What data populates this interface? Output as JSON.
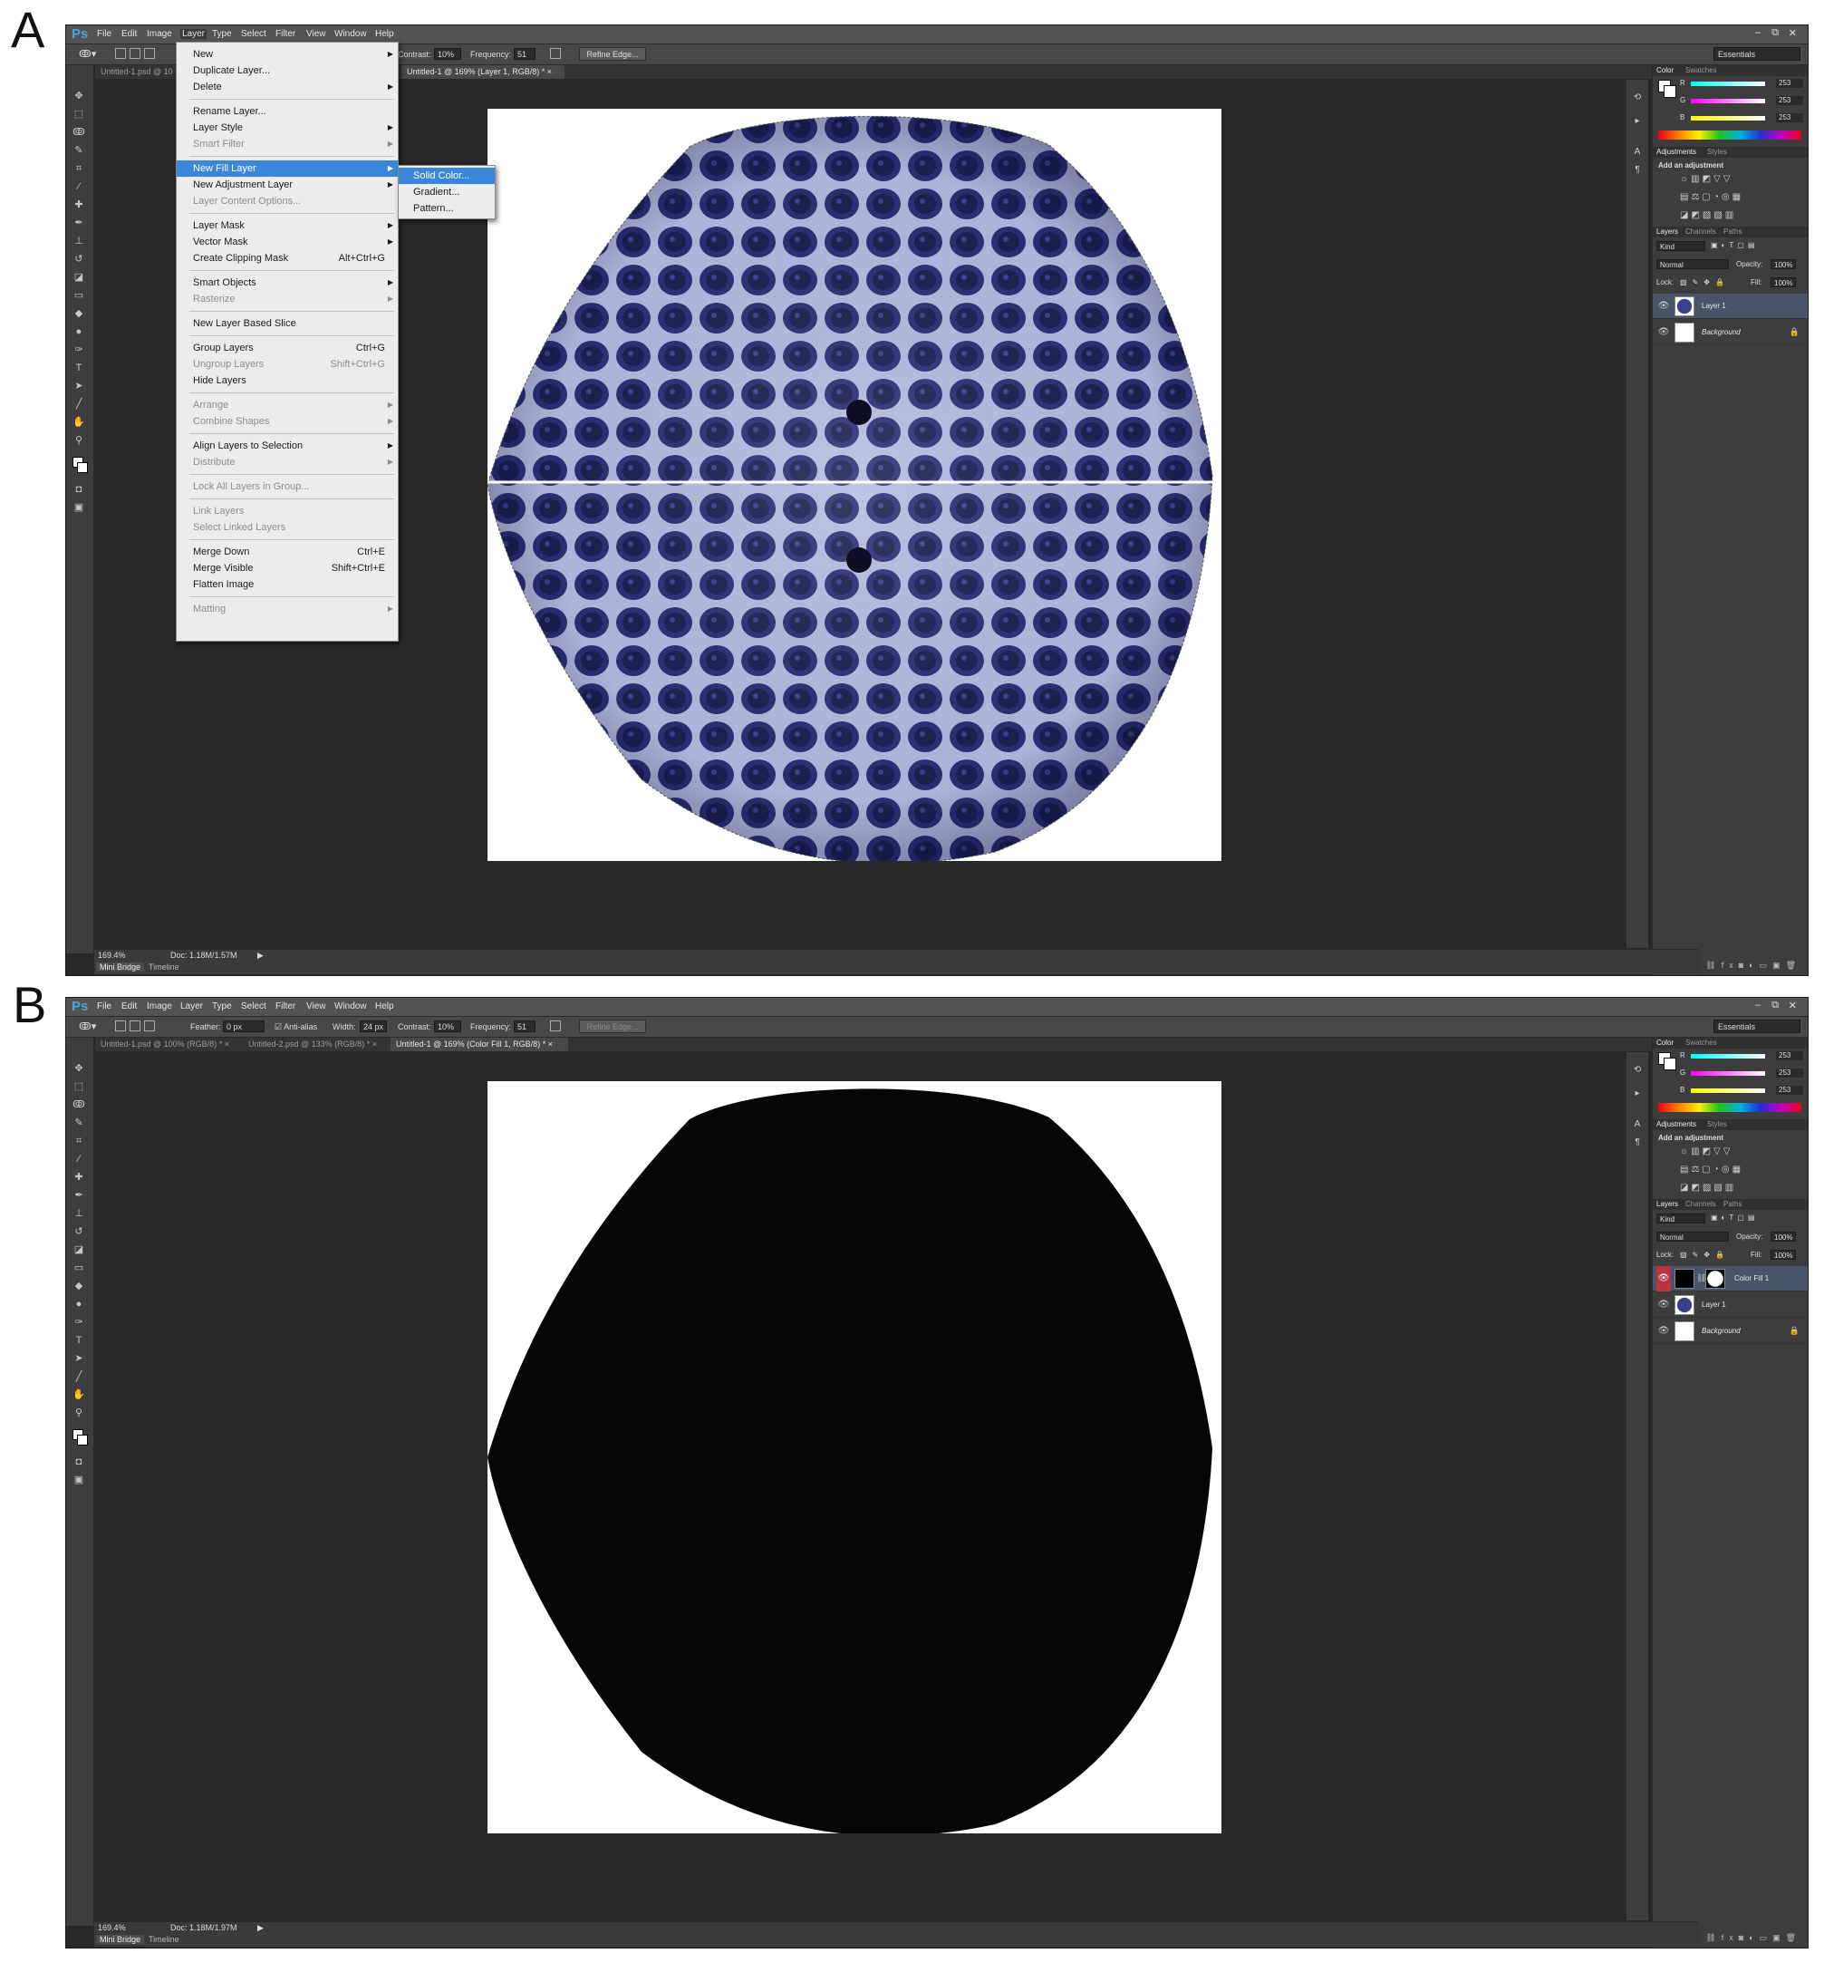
{
  "panel_labels": {
    "a": "A",
    "b": "B"
  },
  "app": {
    "logo": "Ps",
    "menus": [
      "File",
      "Edit",
      "Image",
      "Layer",
      "Type",
      "Select",
      "Filter",
      "View",
      "Window",
      "Help"
    ],
    "window_controls": [
      "–",
      "⧉",
      "✕"
    ],
    "workspace": "Essentials"
  },
  "panel_a": {
    "options": {
      "contrast_label": "Contrast:",
      "contrast_value": "10%",
      "frequency_label": "Frequency:",
      "frequency_value": "51",
      "refine_edge": "Refine Edge..."
    },
    "tabs": [
      {
        "label": "Untitled-1.psd @ 10",
        "active": false
      },
      {
        "label": "Untitled-1 @ 169% (Layer 1, RGB/8) *",
        "active": true
      }
    ],
    "status": {
      "zoom": "169.4%",
      "doc": "Doc: 1.18M/1.57M"
    },
    "layers": [
      {
        "name": "Layer 1",
        "selected": true
      },
      {
        "name": "Background",
        "locked": true
      }
    ],
    "layer_menu": {
      "items": [
        {
          "label": "New",
          "arrow": true
        },
        {
          "label": "Duplicate Layer..."
        },
        {
          "label": "Delete",
          "arrow": true
        },
        {
          "sep": true
        },
        {
          "label": "Rename Layer..."
        },
        {
          "label": "Layer Style",
          "arrow": true
        },
        {
          "label": "Smart Filter",
          "arrow": true,
          "disabled": true
        },
        {
          "sep": true
        },
        {
          "label": "New Fill Layer",
          "arrow": true,
          "highlight": true
        },
        {
          "label": "New Adjustment Layer",
          "arrow": true
        },
        {
          "label": "Layer Content Options...",
          "disabled": true
        },
        {
          "sep": true
        },
        {
          "label": "Layer Mask",
          "arrow": true
        },
        {
          "label": "Vector Mask",
          "arrow": true
        },
        {
          "label": "Create Clipping Mask",
          "shortcut": "Alt+Ctrl+G"
        },
        {
          "sep": true
        },
        {
          "label": "Smart Objects",
          "arrow": true
        },
        {
          "label": "Rasterize",
          "arrow": true,
          "disabled": true
        },
        {
          "sep": true
        },
        {
          "label": "New Layer Based Slice"
        },
        {
          "sep": true
        },
        {
          "label": "Group Layers",
          "shortcut": "Ctrl+G"
        },
        {
          "label": "Ungroup Layers",
          "shortcut": "Shift+Ctrl+G",
          "disabled": true
        },
        {
          "label": "Hide Layers"
        },
        {
          "sep": true
        },
        {
          "label": "Arrange",
          "arrow": true,
          "disabled": true
        },
        {
          "label": "Combine Shapes",
          "arrow": true,
          "disabled": true
        },
        {
          "sep": true
        },
        {
          "label": "Align Layers to Selection",
          "arrow": true
        },
        {
          "label": "Distribute",
          "arrow": true,
          "disabled": true
        },
        {
          "sep": true
        },
        {
          "label": "Lock All Layers in Group...",
          "disabled": true
        },
        {
          "sep": true
        },
        {
          "label": "Link Layers",
          "disabled": true
        },
        {
          "label": "Select Linked Layers",
          "disabled": true
        },
        {
          "sep": true
        },
        {
          "label": "Merge Down",
          "shortcut": "Ctrl+E"
        },
        {
          "label": "Merge Visible",
          "shortcut": "Shift+Ctrl+E"
        },
        {
          "label": "Flatten Image"
        },
        {
          "sep": true
        },
        {
          "label": "Matting",
          "arrow": true,
          "disabled": true
        }
      ],
      "submenu": [
        {
          "label": "Solid Color...",
          "highlight": true
        },
        {
          "label": "Gradient..."
        },
        {
          "label": "Pattern..."
        }
      ]
    }
  },
  "panel_b": {
    "options": {
      "feather_label": "Feather:",
      "feather_value": "0 px",
      "antialias_label": "Anti-alias",
      "width_label": "Width:",
      "width_value": "24 px",
      "contrast_label": "Contrast:",
      "contrast_value": "10%",
      "frequency_label": "Frequency:",
      "frequency_value": "51",
      "refine_edge": "Refine Edge..."
    },
    "tabs": [
      {
        "label": "Untitled-1.psd @ 100% (RGB/8) *",
        "active": false
      },
      {
        "label": "Untitled-2.psd @ 133% (RGB/8) *",
        "active": false
      },
      {
        "label": "Untitled-1 @ 169% (Color Fill 1, RGB/8) *",
        "active": true
      }
    ],
    "status": {
      "zoom": "169.4%",
      "doc": "Doc: 1.18M/1.97M"
    },
    "layers": [
      {
        "name": "Color Fill 1",
        "selected": true
      },
      {
        "name": "Layer 1"
      },
      {
        "name": "Background",
        "locked": true
      }
    ]
  },
  "right_panel": {
    "color_tabs": [
      "Color",
      "Swatches"
    ],
    "channels": [
      {
        "label": "R",
        "value": "253"
      },
      {
        "label": "G",
        "value": "253"
      },
      {
        "label": "B",
        "value": "253"
      }
    ],
    "adjust_tabs": [
      "Adjustments",
      "Styles"
    ],
    "add_adjustment": "Add an adjustment",
    "layers_tabs": [
      "Layers",
      "Channels",
      "Paths"
    ],
    "kind_label": "Kind",
    "blend_mode": "Normal",
    "opacity_label": "Opacity:",
    "opacity_value": "100%",
    "lock_label": "Lock:",
    "fill_label": "Fill:",
    "fill_value": "100%"
  },
  "bottom_tabs": [
    "Mini Bridge",
    "Timeline"
  ],
  "colors": {
    "chrome_dark": "#282828",
    "panel_gray": "#3d3d3d",
    "menu_highlight": "#3a86d9",
    "cells_dark": "#1e2150",
    "cells_mid": "#3b3f86",
    "cells_light": "#c9cbe8",
    "fill_black": "#060606",
    "eye_red": "#b8343f"
  }
}
